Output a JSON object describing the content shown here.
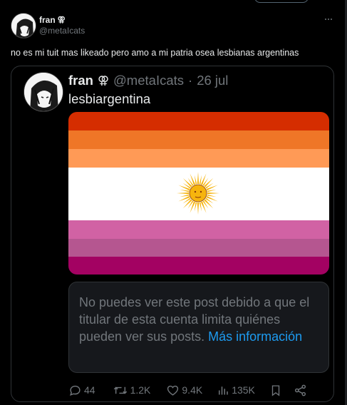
{
  "post": {
    "author_name": "fran",
    "author_symbol": "⚢",
    "author_handle": "@metaIcats",
    "text": "no es mi tuit mas likeado pero amo a mi patria osea lesbianas argentinas"
  },
  "quoted": {
    "author_name": "fran",
    "author_symbol": "⚢",
    "author_handle": "@metaIcats",
    "separator": "·",
    "date": "26 jul",
    "text": "lesbiargentina",
    "flag_colors": [
      "#d52d00",
      "#ef7627",
      "#ff9a56",
      "#ffffff",
      "#d162a4",
      "#b55690",
      "#a30262"
    ],
    "notice_text": "No puedes ver este post debido a que el titular de esta cuenta limita quiénes pueden ver sus posts. ",
    "notice_link": "Más información"
  },
  "actions": {
    "replies": "44",
    "reposts": "1.2K",
    "likes": "9.4K",
    "views": "135K"
  },
  "icons": [
    "more-icon",
    "reply-icon",
    "repost-icon",
    "like-icon",
    "views-icon",
    "bookmark-icon",
    "share-icon"
  ],
  "colors": {
    "background": "#000000",
    "text": "#e7e9ea",
    "secondary": "#71767b",
    "link": "#1d9bf0",
    "border": "#2f3336"
  }
}
